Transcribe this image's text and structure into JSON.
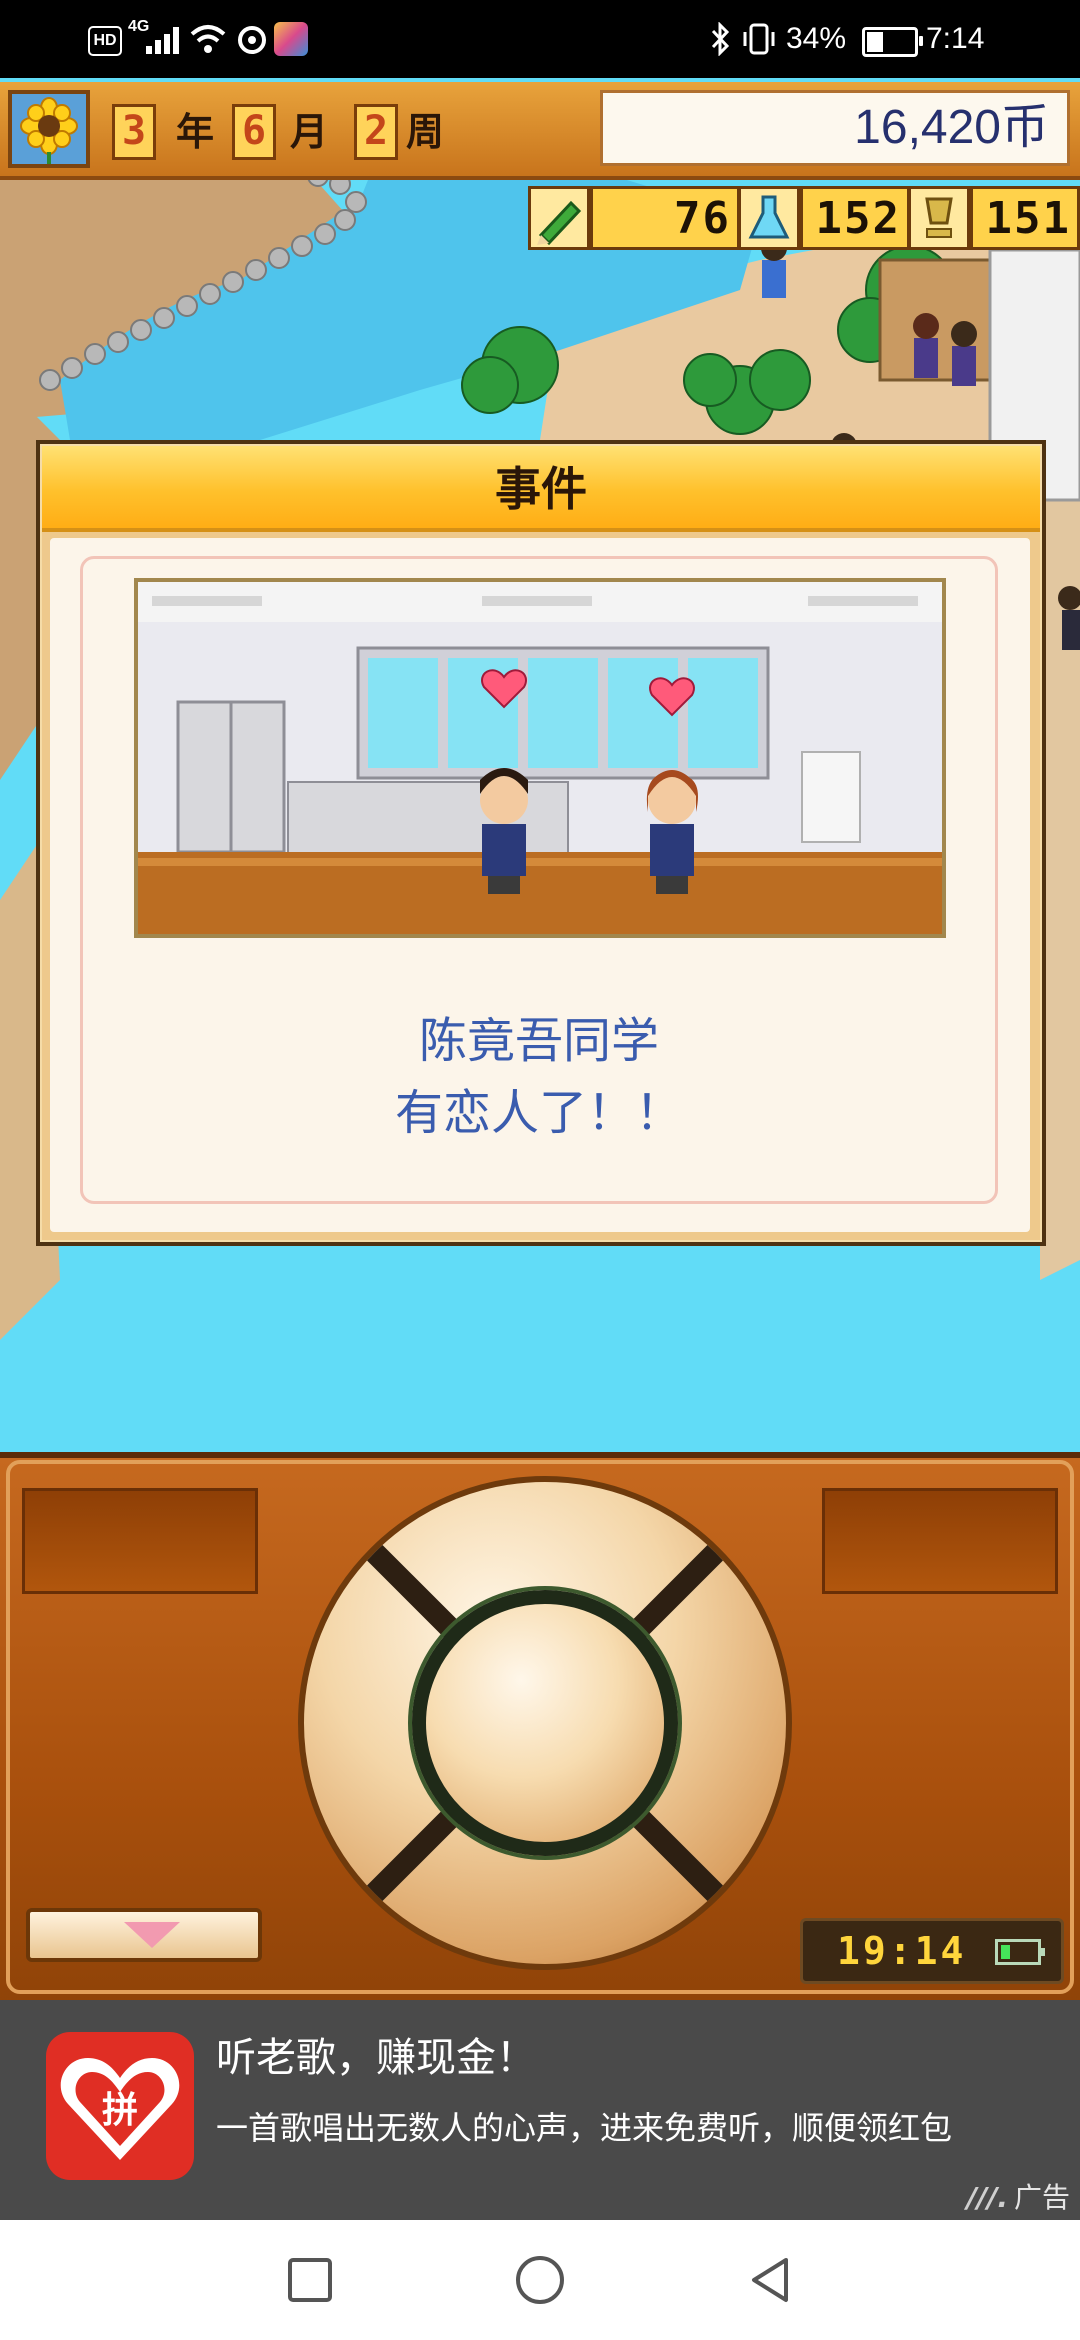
{
  "status_bar": {
    "hd": "HD",
    "network": "4G",
    "battery_percent": "34%",
    "time": "7:14"
  },
  "top_bar": {
    "year": "3",
    "year_unit": "年",
    "month": "6",
    "month_unit": "月",
    "week": "2",
    "week_unit": "周",
    "money": "16,420币",
    "season_icon": "sunflower-icon"
  },
  "stats": {
    "study": "76",
    "research": "152",
    "reputation": "151"
  },
  "event_dialog": {
    "title": "事件",
    "line1": "陈竟吾同学",
    "line2": "有恋人了！！"
  },
  "controller": {
    "clock": "19:14",
    "battery_level": 0.25
  },
  "ad": {
    "title": "听老歌，赚现金！",
    "description": "一首歌唱出无数人的心声，进来免费听，顺便领红包",
    "tag": "广告",
    "logo_text": "拼"
  },
  "colors": {
    "accent_gold": "#ffc12c",
    "text_blue": "#3a5cae",
    "water": "#61dcf7",
    "controller_brown": "#a9500d"
  }
}
